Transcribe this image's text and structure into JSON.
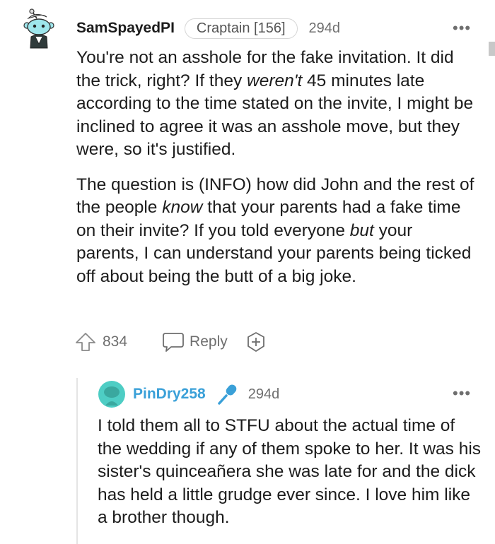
{
  "comment": {
    "username": "SamSpayedPI",
    "flair": "Craptain [156]",
    "age": "294d",
    "more": "•••",
    "body_p1_a": "You're not an asshole for the fake invitation. It did the trick, right? If they ",
    "body_p1_em": "weren't",
    "body_p1_b": " 45 minutes late according to the time stated on the invite, I might be inclined to agree it was an asshole move, but they were, so it's justified.",
    "body_p2_a": "The question is (INFO) how did John and the rest of the people ",
    "body_p2_em1": "know",
    "body_p2_b": " that your parents had a fake time on their invite? If you told everyone ",
    "body_p2_em2": "but",
    "body_p2_c": " your parents, I can understand your parents being ticked off about being the butt of a big joke.",
    "upvotes": "834",
    "reply_label": "Reply"
  },
  "reply": {
    "username": "PinDry258",
    "age": "294d",
    "more": "•••",
    "body": "I told them all to STFU about the actual time of the wedding if any of them spoke to her. It was his sister's quinceañera she was late for and the dick has held a little grudge ever since. I love him like a brother though."
  },
  "colors": {
    "op_badge": "#3aa0d8",
    "avatar_teal": "#4ecdc4",
    "text_muted": "#6e6e6e"
  },
  "icons": {
    "upvote": "upvote-arrow-icon",
    "reply": "chat-bubble-icon",
    "award": "add-award-icon",
    "op": "microphone-icon"
  }
}
